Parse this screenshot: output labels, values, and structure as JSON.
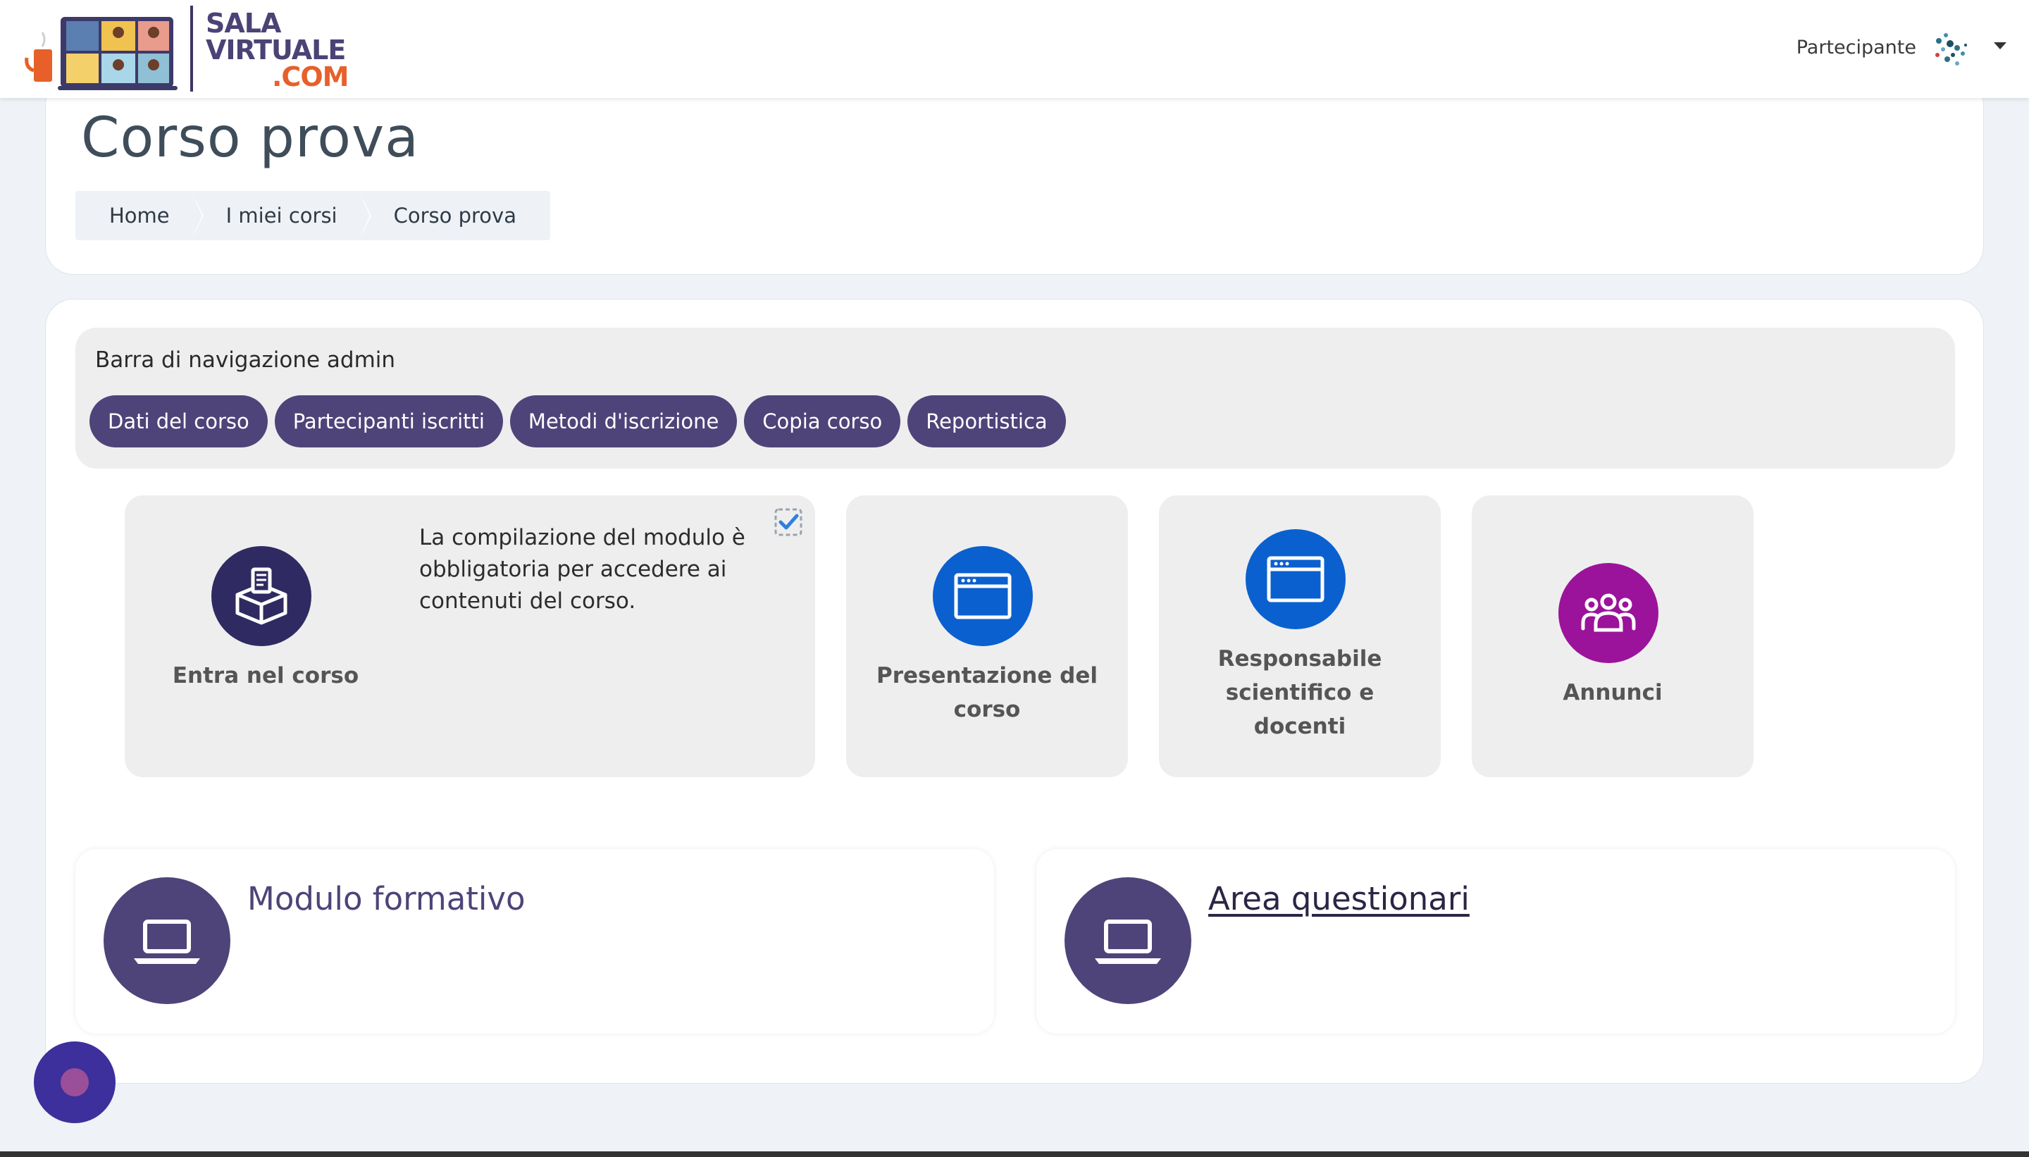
{
  "header": {
    "logo": {
      "line1": "SALA",
      "line2": "VIRTUALE",
      "line3": ".COM"
    },
    "user_role": "Partecipante",
    "avatar": "user-avatar-icon",
    "menu_caret": "caret-down-icon"
  },
  "page": {
    "title": "Corso prova",
    "breadcrumb": [
      "Home",
      "I miei corsi",
      "Corso prova"
    ]
  },
  "admin_bar": {
    "title": "Barra di navigazione admin",
    "buttons": [
      "Dati del corso",
      "Partecipanti iscritti",
      "Metodi d'iscrizione",
      "Copia corso",
      "Reportistica"
    ]
  },
  "tiles": [
    {
      "label": "Entra nel corso",
      "icon": "box-form-icon",
      "description": "La compilazione del modulo è obbligatoria per accedere ai contenuti del corso.",
      "check_icon": "checkbox-checked-icon",
      "color": "#2f2a62"
    },
    {
      "label": "Presentazione del corso",
      "icon": "browser-window-icon",
      "color": "#0b60cf"
    },
    {
      "label": "Responsabile scientifico e docenti",
      "icon": "browser-window-icon",
      "color": "#0b60cf"
    },
    {
      "label": "Annunci",
      "icon": "users-group-icon",
      "color": "#9b139a"
    }
  ],
  "modules": [
    {
      "title": "Modulo formativo",
      "icon": "laptop-icon"
    },
    {
      "title": "Area questionari",
      "icon": "laptop-icon"
    }
  ],
  "colors": {
    "brand_purple": "#4e4479",
    "brand_orange": "#e7602a",
    "page_bg": "#eff3f7"
  }
}
